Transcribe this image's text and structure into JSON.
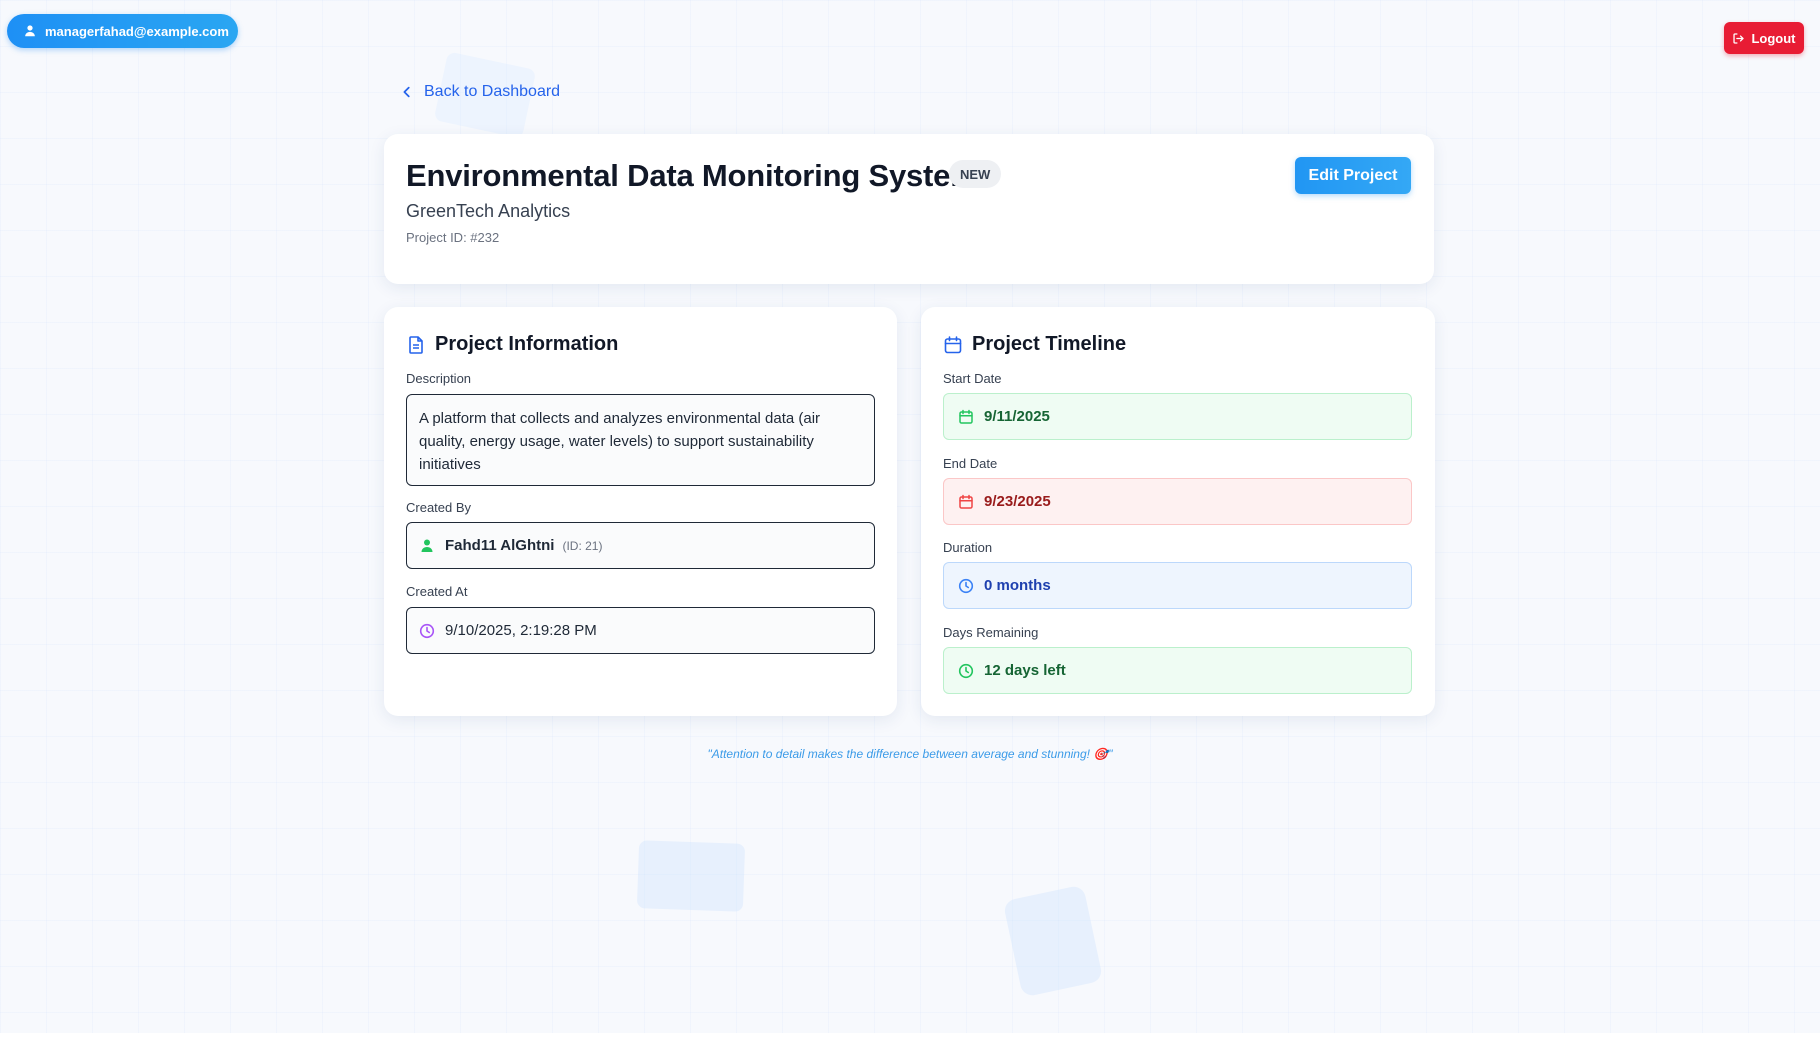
{
  "user": {
    "email": "managerfahad@example.com"
  },
  "logout_label": "Logout",
  "back_link": "Back to Dashboard",
  "project": {
    "title": "Environmental Data Monitoring System",
    "badge": "NEW",
    "company": "GreenTech Analytics",
    "id_text": "Project ID: #232",
    "edit_label": "Edit Project"
  },
  "info": {
    "title": "Project Information",
    "description_label": "Description",
    "description": "A platform that collects and analyzes environmental data (air quality, energy usage, water levels) to support sustainability initiatives",
    "created_by_label": "Created By",
    "created_by_name": "Fahd11 AlGhtni",
    "created_by_id": "(ID: 21)",
    "created_at_label": "Created At",
    "created_at": "9/10/2025, 2:19:28 PM"
  },
  "timeline": {
    "title": "Project Timeline",
    "start_label": "Start Date",
    "start_date": "9/11/2025",
    "end_label": "End Date",
    "end_date": "9/23/2025",
    "duration_label": "Duration",
    "duration": "0 months",
    "remaining_label": "Days Remaining",
    "remaining": "12 days left"
  },
  "quote": "\"Attention to detail makes the difference between average and stunning! 🎯\"",
  "colors": {
    "primary": "#2196f3",
    "danger": "#e81c34",
    "success": "#22c55e",
    "accent_purple": "#a855f7"
  }
}
